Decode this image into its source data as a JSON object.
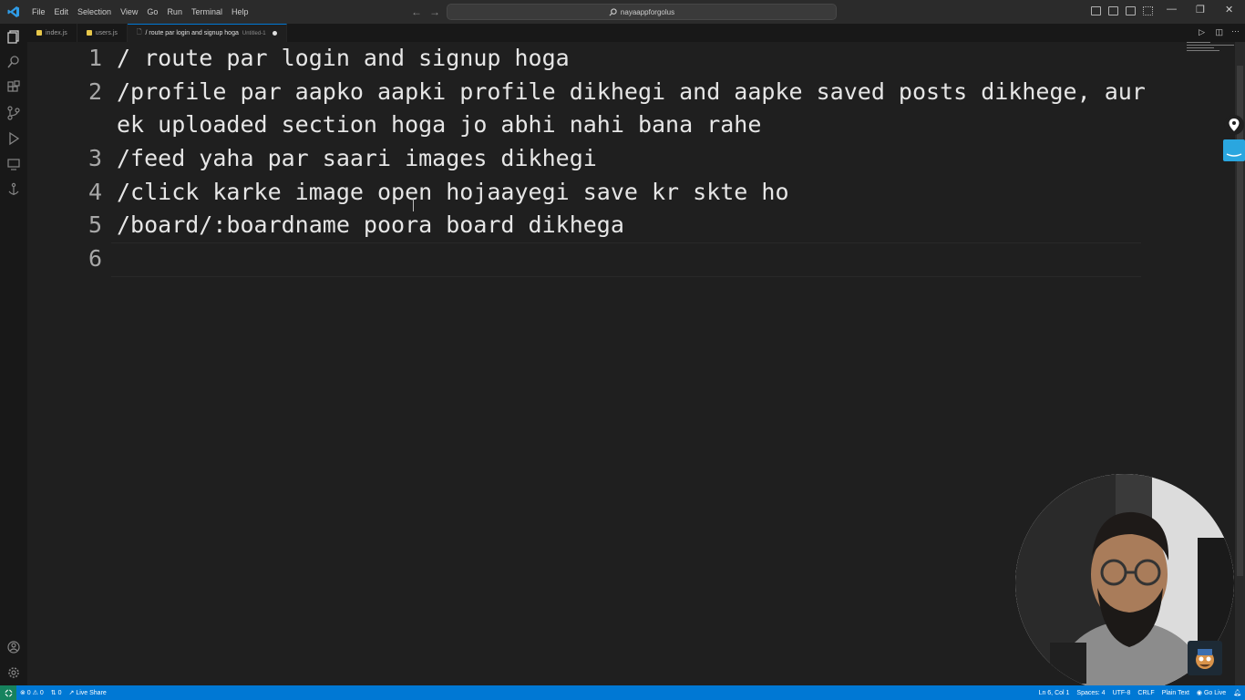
{
  "menu": [
    "File",
    "Edit",
    "Selection",
    "View",
    "Go",
    "Run",
    "Terminal",
    "Help"
  ],
  "search": {
    "label": "nayaappforgolus"
  },
  "tabs": [
    {
      "label": "index.js",
      "icon": "js-file-icon",
      "sub": ""
    },
    {
      "label": "users.js",
      "icon": "js-file-icon",
      "sub": ""
    },
    {
      "label": "/ route par login and signup hoga",
      "icon": "text-file-icon",
      "sub": "Untitled-1"
    }
  ],
  "editor": {
    "lines": [
      {
        "num": "1",
        "text": "/ route par login and signup hoga"
      },
      {
        "num": "2",
        "text": "/profile par aapko aapki profile dikhegi and aapke saved posts dikhege, aur"
      },
      {
        "num": "",
        "text": "ek uploaded section hoga jo abhi nahi bana rahe"
      },
      {
        "num": "3",
        "text": "/feed yaha par saari images dikhegi"
      },
      {
        "num": "4",
        "text": "/click karke image open hojaayegi save kr skte ho"
      },
      {
        "num": "5",
        "text": "/board/:boardname poora board dikhega"
      },
      {
        "num": "6",
        "text": ""
      }
    ]
  },
  "statusbar": {
    "problems": "⊗ 0 ⚠ 0",
    "ports": "0",
    "live_share": "Live Share",
    "position": "Ln 6, Col 1",
    "spaces": "Spaces: 4",
    "encoding": "UTF-8",
    "eol": "CRLF",
    "language": "Plain Text",
    "go_live": "Go Live"
  },
  "colors": {
    "accent": "#0078d4",
    "editor_bg": "#1f1f1f",
    "remote": "#16825d"
  }
}
